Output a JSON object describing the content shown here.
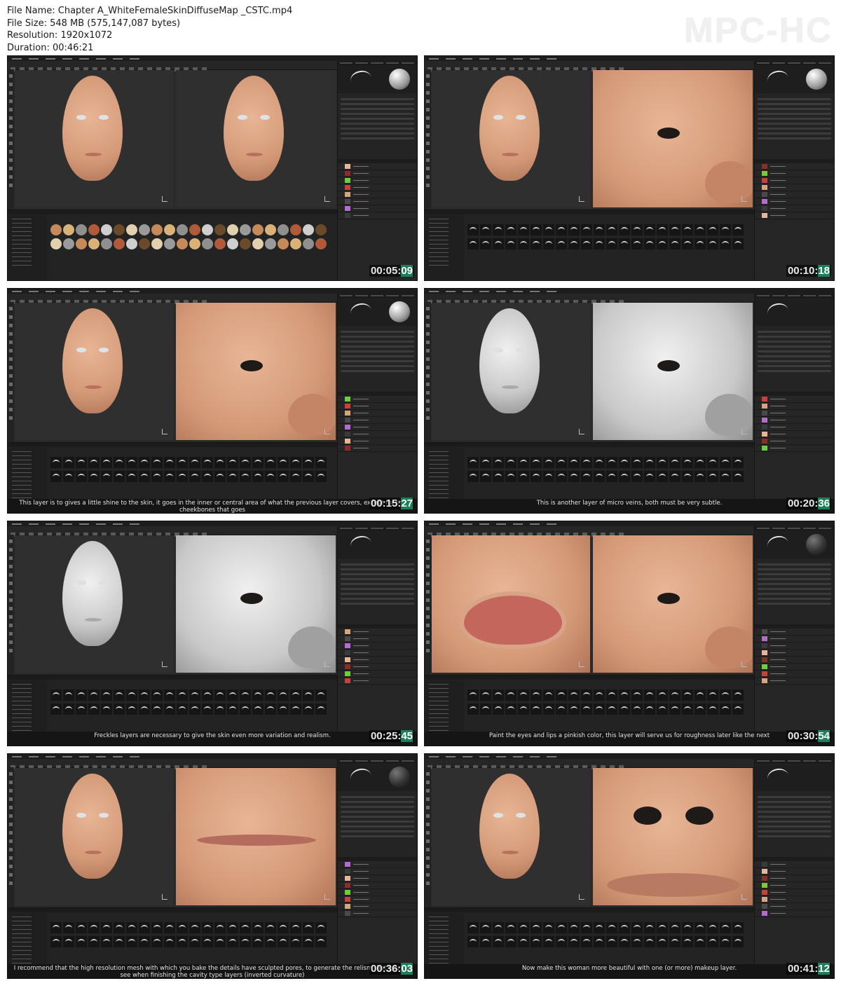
{
  "file_info": {
    "file_name": "File Name: Chapter A_WhiteFemaleSkinDiffuseMap _CSTC.mp4",
    "file_size": "File Size: 548 MB (575,147,087 bytes)",
    "resolution": "Resolution: 1920x1072",
    "duration": "Duration: 00:46:21"
  },
  "brand": "MPC-HC",
  "thumbnails": [
    {
      "time_main": "00:05:",
      "time_sub": "09",
      "caption": "",
      "vp1": "skin",
      "vp2": "skin",
      "sphere": "light"
    },
    {
      "time_main": "00:10:",
      "time_sub": "18",
      "caption": "",
      "vp1": "skin",
      "vp2": "skin-face",
      "sphere": "light"
    },
    {
      "time_main": "00:15:",
      "time_sub": "27",
      "caption": "This layer is to gives a little shine to the skin, it goes in the inner or central area of what the previous layer covers, except for the cheekbones that goes",
      "vp1": "skin",
      "vp2": "skin-face",
      "sphere": "light"
    },
    {
      "time_main": "00:20:",
      "time_sub": "36",
      "caption": "This is another layer of micro veins, both must be very subtle.",
      "vp1": "grey",
      "vp2": "grey-face",
      "sphere": "none"
    },
    {
      "time_main": "00:25:",
      "time_sub": "45",
      "caption": "Freckles layers are necessary to give the skin even more variation and realism.",
      "vp1": "grey",
      "vp2": "grey-face",
      "sphere": "none"
    },
    {
      "time_main": "00:30:",
      "time_sub": "54",
      "caption": "Paint the eyes and lips a pinkish color, this layer will serve us for roughness later like the next",
      "vp1": "eye-close",
      "vp2": "skin-face",
      "sphere": "dark"
    },
    {
      "time_main": "00:36:",
      "time_sub": "03",
      "caption": "I recommend that the high resolution mesh with which you bake the details have sculpted pores, to generate the relism that you will see when finishing the cavity type layers (inverted curvature)",
      "vp1": "skin",
      "vp2": "lips",
      "sphere": "dark"
    },
    {
      "time_main": "00:41:",
      "time_sub": "12",
      "caption": "Now make this woman more beautiful with one (or more) makeup layer.",
      "vp1": "skin",
      "vp2": "nose-lips",
      "sphere": "none"
    }
  ]
}
